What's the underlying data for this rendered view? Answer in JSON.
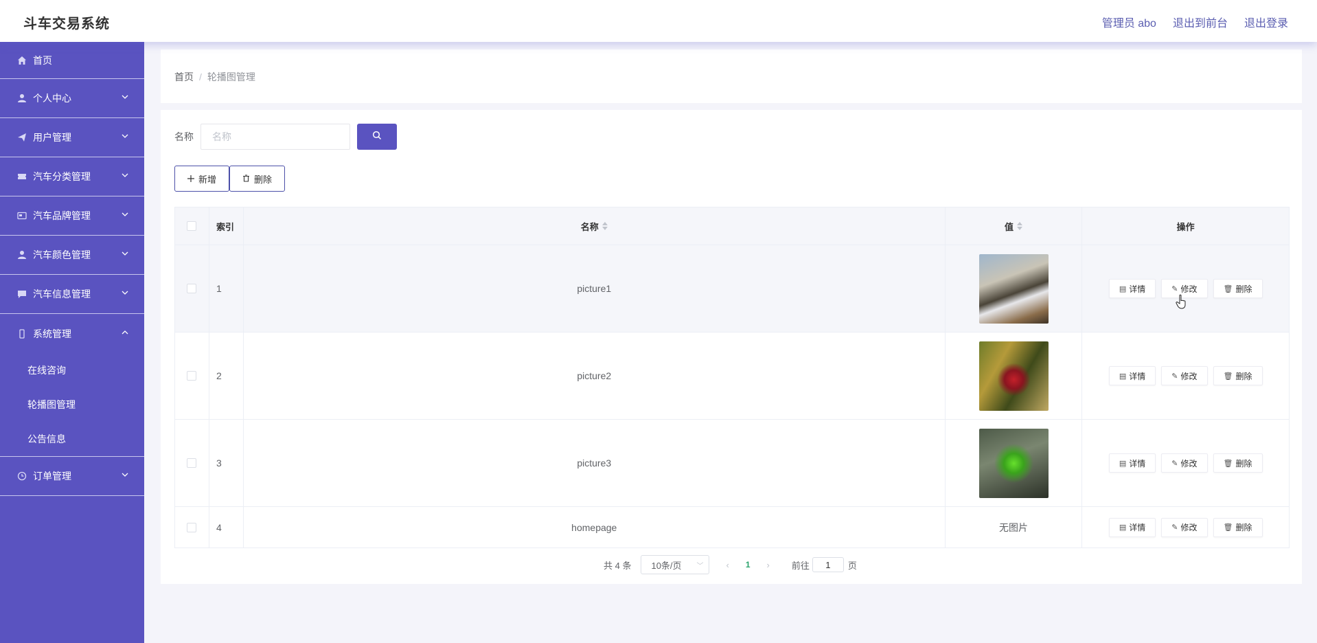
{
  "header": {
    "app_title": "斗车交易系统",
    "admin_label": "管理员 abo",
    "to_front": "退出到前台",
    "logout": "退出登录"
  },
  "sidebar": {
    "items": [
      {
        "label": "首页",
        "icon": "home-icon"
      },
      {
        "label": "个人中心",
        "icon": "user-icon"
      },
      {
        "label": "用户管理",
        "icon": "send-icon"
      },
      {
        "label": "汽车分类管理",
        "icon": "ticket-icon"
      },
      {
        "label": "汽车品牌管理",
        "icon": "card-icon"
      },
      {
        "label": "汽车颜色管理",
        "icon": "user-icon"
      },
      {
        "label": "汽车信息管理",
        "icon": "chat-icon"
      },
      {
        "label": "系统管理",
        "icon": "phone-icon"
      },
      {
        "label": "订单管理",
        "icon": "clock-icon"
      }
    ],
    "system_sub": [
      "在线咨询",
      "轮播图管理",
      "公告信息"
    ]
  },
  "breadcrumb": {
    "home": "首页",
    "separator": "/",
    "current": "轮播图管理"
  },
  "search": {
    "label": "名称",
    "placeholder": "名称",
    "value": ""
  },
  "actions": {
    "add": "新增",
    "delete": "删除"
  },
  "table": {
    "headers": {
      "index": "索引",
      "name": "名称",
      "value": "值",
      "ops": "操作"
    },
    "rows": [
      {
        "index": "1",
        "name": "picture1",
        "has_image": true
      },
      {
        "index": "2",
        "name": "picture2",
        "has_image": true
      },
      {
        "index": "3",
        "name": "picture3",
        "has_image": true
      },
      {
        "index": "4",
        "name": "homepage",
        "value_text": "无图片",
        "has_image": false
      }
    ],
    "op_labels": {
      "detail": "详情",
      "edit": "修改",
      "delete": "删除"
    }
  },
  "pagination": {
    "total": "共 4 条",
    "page_size": "10条/页",
    "current_page": "1",
    "goto_label": "前往",
    "goto_value": "1",
    "page_suffix": "页"
  },
  "colors": {
    "sidebar_bg": "#5a53c0",
    "accent": "#5a53c0",
    "link": "#5a5db0"
  }
}
